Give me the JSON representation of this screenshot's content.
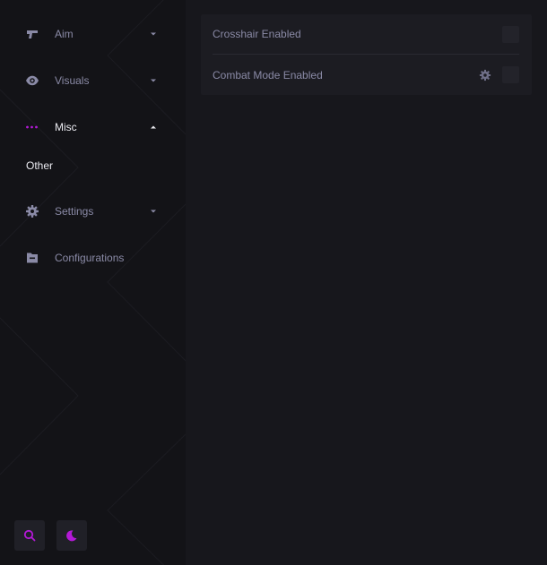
{
  "sidebar": {
    "items": [
      {
        "label": "Aim",
        "icon": "pistol-icon",
        "expanded": false
      },
      {
        "label": "Visuals",
        "icon": "eye-icon",
        "expanded": false
      },
      {
        "label": "Misc",
        "icon": "dots-icon",
        "expanded": true,
        "active": true
      },
      {
        "label": "Settings",
        "icon": "gear-icon",
        "expanded": false
      },
      {
        "label": "Configurations",
        "icon": "folder-icon"
      }
    ],
    "subitems": {
      "misc": [
        {
          "label": "Other"
        }
      ]
    },
    "bottom_buttons": [
      {
        "icon": "search-icon"
      },
      {
        "icon": "moon-icon"
      }
    ]
  },
  "main": {
    "settings": [
      {
        "label": "Crosshair Enabled",
        "enabled": false
      },
      {
        "label": "Combat Mode Enabled",
        "enabled": false,
        "has_settings": true
      }
    ]
  },
  "colors": {
    "accent": "#b319d6",
    "text_active": "#ececf2",
    "text_muted": "#8a8aa6",
    "background": "#16161b"
  }
}
